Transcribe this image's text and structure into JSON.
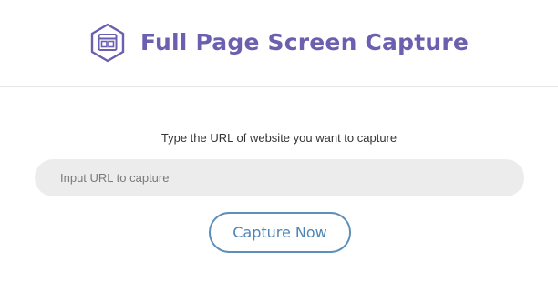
{
  "app": {
    "title": "Full Page Screen Capture",
    "logo_icon": "browser-window-hexagon-icon",
    "brand_color": "#6b5fb0"
  },
  "form": {
    "prompt": "Type the URL of website you want to capture",
    "url_input": {
      "value": "",
      "placeholder": "Input URL to capture"
    },
    "capture_button_label": "Capture Now",
    "button_color": "#5d8fba"
  }
}
